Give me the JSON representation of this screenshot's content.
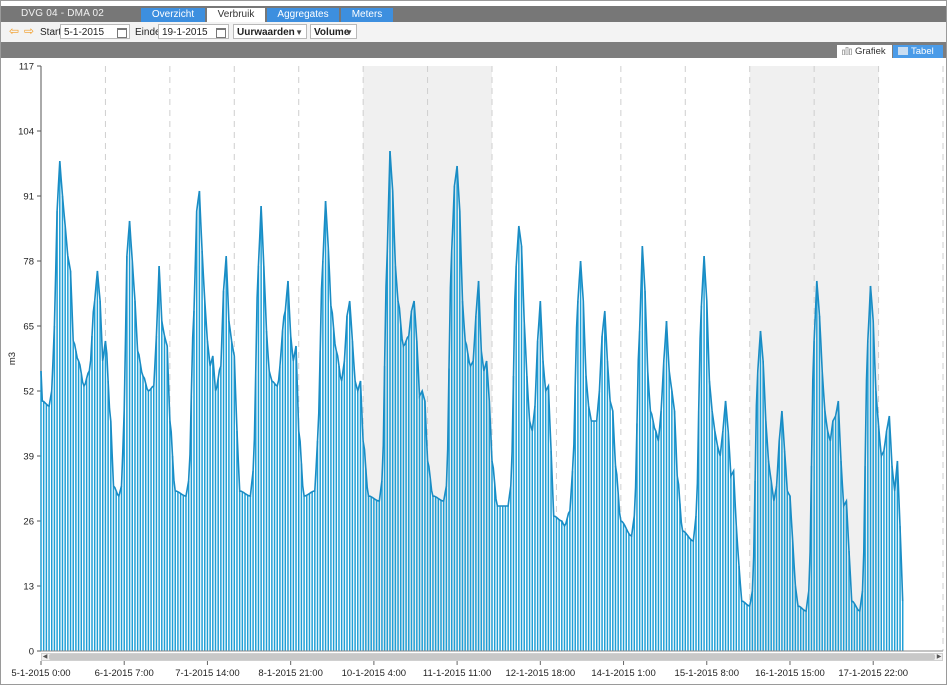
{
  "window": {
    "title": "DVG 04 - DMA 02"
  },
  "tabs": [
    {
      "label": "Overzicht",
      "active": false
    },
    {
      "label": "Verbruik",
      "active": true
    },
    {
      "label": "Aggregates",
      "active": false
    },
    {
      "label": "Meters",
      "active": false
    }
  ],
  "toolbar": {
    "start_label": "Start",
    "start_value": "5-1-2015",
    "end_label": "Einde",
    "end_value": "19-1-2015",
    "interval_select": "Uurwaarden",
    "measure_select": "Volume"
  },
  "view_toggle": {
    "chart_label": "Grafiek",
    "table_label": "Tabel",
    "active": "Tabel"
  },
  "colors": {
    "series": "#1f9fd6",
    "series_line": "#1a8cc4",
    "tab_active_bg": "#ffffff",
    "tab_bg": "#3d8fdf",
    "weekend_band": "#f0f0f0"
  },
  "chart_data": {
    "type": "area",
    "ylabel": "m3",
    "ylim": [
      0,
      117
    ],
    "yticks": [
      "0",
      "13",
      "26",
      "39",
      "52",
      "65",
      "78",
      "91",
      "104",
      "117"
    ],
    "xlabels": [
      "5-1-2015 0:00",
      "6-1-2015 7:00",
      "7-1-2015 14:00",
      "8-1-2015 21:00",
      "10-1-2015 4:00",
      "11-1-2015 11:00",
      "12-1-2015 18:00",
      "14-1-2015 1:00",
      "15-1-2015 8:00",
      "16-1-2015 15:00",
      "17-1-2015 22:00"
    ],
    "xrange_hours": [
      0,
      336
    ],
    "shaded_days": [
      5,
      6,
      11,
      12
    ],
    "grid": "vertical dashed per day",
    "daily_peaks": [
      [
        0,
        56
      ],
      [
        0.5,
        50
      ],
      [
        3,
        49
      ],
      [
        4,
        52
      ],
      [
        5,
        65
      ],
      [
        6,
        88
      ],
      [
        7,
        98
      ],
      [
        8,
        91
      ],
      [
        9,
        85
      ],
      [
        10,
        79
      ],
      [
        11,
        76
      ],
      [
        12,
        62
      ],
      [
        14,
        58
      ],
      [
        16,
        53
      ],
      [
        18,
        56
      ],
      [
        20,
        70
      ],
      [
        21,
        76
      ],
      [
        22,
        70
      ],
      [
        23,
        58
      ],
      [
        24,
        62
      ],
      [
        26,
        46
      ],
      [
        27,
        33
      ],
      [
        29,
        31
      ],
      [
        30,
        33
      ],
      [
        31,
        48
      ],
      [
        32,
        79
      ],
      [
        33,
        86
      ],
      [
        34,
        78
      ],
      [
        35,
        70
      ],
      [
        36,
        60
      ],
      [
        38,
        55
      ],
      [
        40,
        52
      ],
      [
        42,
        53
      ],
      [
        43,
        63
      ],
      [
        44,
        77
      ],
      [
        45,
        66
      ],
      [
        46,
        63
      ],
      [
        47,
        61
      ],
      [
        48,
        46
      ],
      [
        50,
        32
      ],
      [
        54,
        31
      ],
      [
        55,
        34
      ],
      [
        57,
        68
      ],
      [
        58,
        88
      ],
      [
        59,
        92
      ],
      [
        60,
        80
      ],
      [
        61,
        70
      ],
      [
        62,
        62
      ],
      [
        63,
        57
      ],
      [
        64,
        59
      ],
      [
        65,
        52
      ],
      [
        67,
        57
      ],
      [
        68,
        72
      ],
      [
        69,
        79
      ],
      [
        70,
        66
      ],
      [
        71,
        62
      ],
      [
        72,
        59
      ],
      [
        73,
        44
      ],
      [
        74,
        32
      ],
      [
        78,
        31
      ],
      [
        79,
        36
      ],
      [
        81,
        77
      ],
      [
        82,
        89
      ],
      [
        83,
        77
      ],
      [
        84,
        64
      ],
      [
        85,
        56
      ],
      [
        86,
        54
      ],
      [
        88,
        53
      ],
      [
        91,
        68
      ],
      [
        92,
        74
      ],
      [
        93,
        63
      ],
      [
        94,
        58
      ],
      [
        95,
        61
      ],
      [
        96,
        44
      ],
      [
        98,
        31
      ],
      [
        102,
        32
      ],
      [
        103,
        42
      ],
      [
        105,
        78
      ],
      [
        106,
        90
      ],
      [
        107,
        81
      ],
      [
        108,
        69
      ],
      [
        110,
        60
      ],
      [
        112,
        54
      ],
      [
        113,
        58
      ],
      [
        114,
        67
      ],
      [
        115,
        70
      ],
      [
        116,
        62
      ],
      [
        117,
        54
      ],
      [
        118,
        52
      ],
      [
        119,
        54
      ],
      [
        120,
        42
      ],
      [
        122,
        31
      ],
      [
        126,
        30
      ],
      [
        127,
        34
      ],
      [
        129,
        80
      ],
      [
        130,
        100
      ],
      [
        131,
        92
      ],
      [
        132,
        77
      ],
      [
        133,
        70
      ],
      [
        135,
        61
      ],
      [
        137,
        63
      ],
      [
        138,
        68
      ],
      [
        139,
        70
      ],
      [
        140,
        62
      ],
      [
        141,
        51
      ],
      [
        142,
        52
      ],
      [
        143,
        50
      ],
      [
        144,
        38
      ],
      [
        146,
        31
      ],
      [
        150,
        30
      ],
      [
        151,
        33
      ],
      [
        153,
        80
      ],
      [
        154,
        93
      ],
      [
        155,
        97
      ],
      [
        156,
        88
      ],
      [
        157,
        70
      ],
      [
        158,
        62
      ],
      [
        160,
        57
      ],
      [
        161,
        58
      ],
      [
        162,
        67
      ],
      [
        163,
        74
      ],
      [
        164,
        60
      ],
      [
        165,
        56
      ],
      [
        166,
        58
      ],
      [
        167,
        50
      ],
      [
        168,
        38
      ],
      [
        170,
        29
      ],
      [
        174,
        29
      ],
      [
        175,
        33
      ],
      [
        177,
        77
      ],
      [
        178,
        85
      ],
      [
        179,
        81
      ],
      [
        180,
        66
      ],
      [
        181,
        55
      ],
      [
        182,
        46
      ],
      [
        183,
        44
      ],
      [
        184,
        49
      ],
      [
        185,
        62
      ],
      [
        186,
        70
      ],
      [
        187,
        58
      ],
      [
        188,
        52
      ],
      [
        189,
        53
      ],
      [
        190,
        40
      ],
      [
        191,
        27
      ],
      [
        194,
        26
      ],
      [
        195,
        25
      ],
      [
        197,
        28
      ],
      [
        198,
        36
      ],
      [
        200,
        70
      ],
      [
        201,
        78
      ],
      [
        202,
        70
      ],
      [
        203,
        55
      ],
      [
        204,
        49
      ],
      [
        205,
        46
      ],
      [
        207,
        46
      ],
      [
        208,
        52
      ],
      [
        209,
        63
      ],
      [
        210,
        68
      ],
      [
        211,
        58
      ],
      [
        212,
        50
      ],
      [
        213,
        48
      ],
      [
        214,
        37
      ],
      [
        216,
        26
      ],
      [
        220,
        23
      ],
      [
        221,
        27
      ],
      [
        223,
        64
      ],
      [
        224,
        81
      ],
      [
        225,
        72
      ],
      [
        226,
        56
      ],
      [
        227,
        48
      ],
      [
        229,
        44
      ],
      [
        230,
        42
      ],
      [
        231,
        48
      ],
      [
        232,
        58
      ],
      [
        233,
        66
      ],
      [
        234,
        56
      ],
      [
        235,
        52
      ],
      [
        236,
        48
      ],
      [
        237,
        35
      ],
      [
        239,
        24
      ],
      [
        243,
        22
      ],
      [
        244,
        27
      ],
      [
        246,
        69
      ],
      [
        247,
        79
      ],
      [
        248,
        70
      ],
      [
        249,
        54
      ],
      [
        250,
        48
      ],
      [
        251,
        44
      ],
      [
        252,
        41
      ],
      [
        253,
        39
      ],
      [
        254,
        44
      ],
      [
        255,
        50
      ],
      [
        256,
        44
      ],
      [
        257,
        35
      ],
      [
        258,
        36
      ],
      [
        259,
        25
      ],
      [
        260,
        17
      ],
      [
        261,
        10
      ],
      [
        264,
        9
      ],
      [
        265,
        12
      ],
      [
        267,
        56
      ],
      [
        268,
        64
      ],
      [
        269,
        58
      ],
      [
        270,
        46
      ],
      [
        271,
        38
      ],
      [
        272,
        34
      ],
      [
        273,
        30
      ],
      [
        274,
        33
      ],
      [
        275,
        42
      ],
      [
        276,
        48
      ],
      [
        277,
        40
      ],
      [
        278,
        32
      ],
      [
        279,
        31
      ],
      [
        280,
        22
      ],
      [
        281,
        13
      ],
      [
        282,
        9
      ],
      [
        285,
        8
      ],
      [
        286,
        12
      ],
      [
        288,
        62
      ],
      [
        289,
        74
      ],
      [
        290,
        67
      ],
      [
        291,
        56
      ],
      [
        292,
        48
      ],
      [
        293,
        44
      ],
      [
        294,
        42
      ],
      [
        295,
        46
      ],
      [
        296,
        47
      ],
      [
        297,
        50
      ],
      [
        298,
        38
      ],
      [
        299,
        29
      ],
      [
        300,
        30
      ],
      [
        301,
        20
      ],
      [
        302,
        10
      ],
      [
        305,
        8
      ],
      [
        306,
        12
      ],
      [
        308,
        62
      ],
      [
        309,
        73
      ],
      [
        310,
        66
      ],
      [
        311,
        52
      ],
      [
        312,
        45
      ],
      [
        313,
        39
      ],
      [
        314,
        40
      ],
      [
        315,
        44
      ],
      [
        316,
        47
      ],
      [
        317,
        37
      ],
      [
        318,
        32
      ],
      [
        319,
        38
      ],
      [
        320,
        25
      ],
      [
        321,
        10
      ]
    ]
  }
}
